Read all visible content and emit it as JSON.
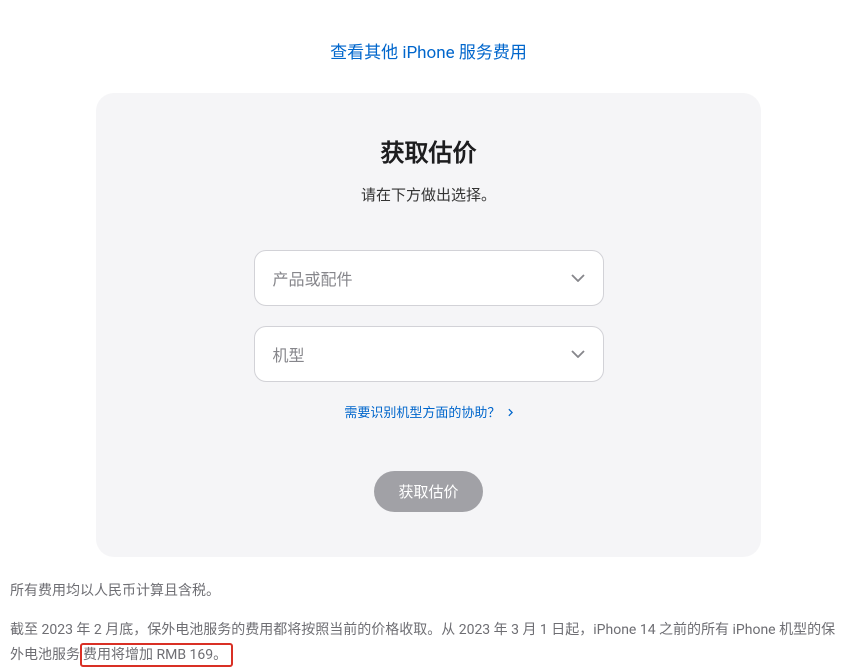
{
  "topLink": {
    "text": "查看其他 iPhone 服务费用"
  },
  "card": {
    "title": "获取估价",
    "subtitle": "请在下方做出选择。",
    "select1": {
      "placeholder": "产品或配件"
    },
    "select2": {
      "placeholder": "机型"
    },
    "helpLink": {
      "text": "需要识别机型方面的协助？"
    },
    "submitButton": {
      "label": "获取估价"
    }
  },
  "footer": {
    "line1": "所有费用均以人民币计算且含税。",
    "line2_part1": "截至 2023 年 2 月底，保外电池服务的费用都将按照当前的价格收取。从 2023 年 3 月 1 日起，iPhone 14 之前的所有 iPhone 机型的保外电池服务",
    "line2_highlight": "费用将增加 RMB 169。"
  }
}
